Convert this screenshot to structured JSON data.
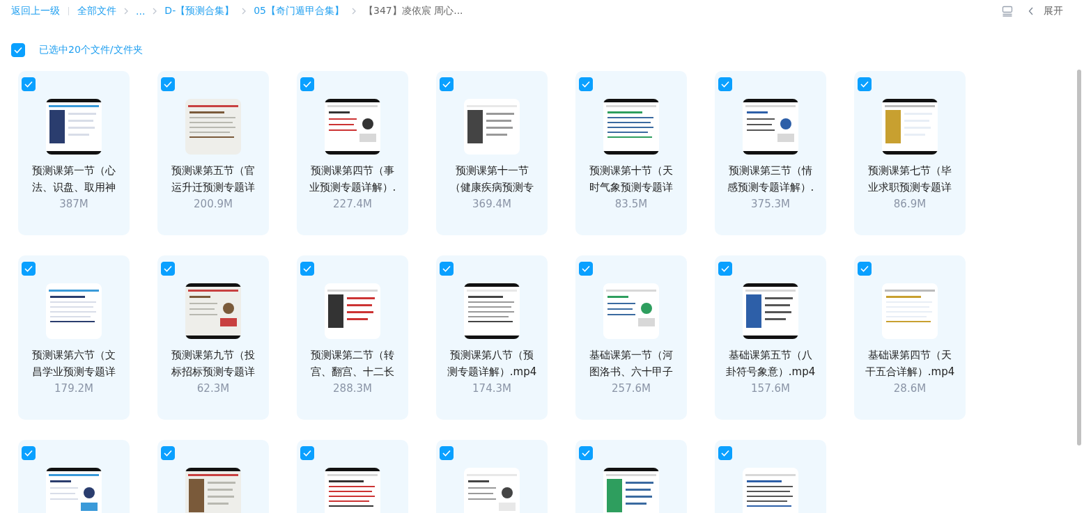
{
  "breadcrumb": {
    "back": "返回上一级",
    "items": [
      {
        "label": "全部文件",
        "current": false
      },
      {
        "label": "...",
        "current": false
      },
      {
        "label": "D-【预测合集】",
        "current": false
      },
      {
        "label": "05【奇门遁甲合集】",
        "current": false
      },
      {
        "label": "【347】凌依宸 周心...",
        "current": true
      }
    ]
  },
  "toolbar": {
    "expand": "展开"
  },
  "selection": {
    "checked": true,
    "label": "已选中20个文件/文件夹"
  },
  "files": [
    {
      "checked": true,
      "name_lines": [
        "预测课第一节（心",
        "法、识盘、取用神"
      ],
      "size": "387M",
      "kind": "picture"
    },
    {
      "checked": true,
      "name_lines": [
        "预测课第五节（官",
        "运升迁预测专题详"
      ],
      "size": "200.9M",
      "kind": "picture"
    },
    {
      "checked": true,
      "name_lines": [
        "预测课第四节（事",
        "业预测专题详解）."
      ],
      "size": "227.4M",
      "kind": "picture"
    },
    {
      "checked": true,
      "name_lines": [
        "预测课第十一节",
        "（健康疾病预测专"
      ],
      "size": "369.4M",
      "kind": "picture"
    },
    {
      "checked": true,
      "name_lines": [
        "预测课第十节（天",
        "时气象预测专题详"
      ],
      "size": "83.5M",
      "kind": "picture"
    },
    {
      "checked": true,
      "name_lines": [
        "预测课第三节（情",
        "感预测专题详解）."
      ],
      "size": "375.3M",
      "kind": "picture"
    },
    {
      "checked": true,
      "name_lines": [
        "预测课第七节（毕",
        "业求职预测专题详"
      ],
      "size": "86.9M",
      "kind": "picture"
    },
    {
      "checked": true,
      "name_lines": [
        "预测课第六节（文",
        "昌学业预测专题详"
      ],
      "size": "179.2M",
      "kind": "picture"
    },
    {
      "checked": true,
      "name_lines": [
        "预测课第九节（投",
        "标招标预测专题详"
      ],
      "size": "62.3M",
      "kind": "picture"
    },
    {
      "checked": true,
      "name_lines": [
        "预测课第二节（转",
        "宫、翻宫、十二长"
      ],
      "size": "288.3M",
      "kind": "picture"
    },
    {
      "checked": true,
      "name_lines": [
        "预测课第八节（预",
        "测专题详解）.mp4"
      ],
      "size": "174.3M",
      "kind": "picture"
    },
    {
      "checked": true,
      "name_lines": [
        "基础课第一节（河",
        "图洛书、六十甲子"
      ],
      "size": "257.6M",
      "kind": "picture"
    },
    {
      "checked": true,
      "name_lines": [
        "基础课第五节（八",
        "卦符号象意）.mp4"
      ],
      "size": "157.6M",
      "kind": "picture"
    },
    {
      "checked": true,
      "name_lines": [
        "基础课第四节（天",
        "干五合详解）.mp4"
      ],
      "size": "28.6M",
      "kind": "picture"
    },
    {
      "checked": true,
      "kind": "picture"
    },
    {
      "checked": true,
      "kind": "picture"
    },
    {
      "checked": true,
      "kind": "picture"
    },
    {
      "checked": true,
      "kind": "picture"
    },
    {
      "checked": true,
      "kind": "picture"
    },
    {
      "checked": true,
      "kind": "picture"
    }
  ]
}
